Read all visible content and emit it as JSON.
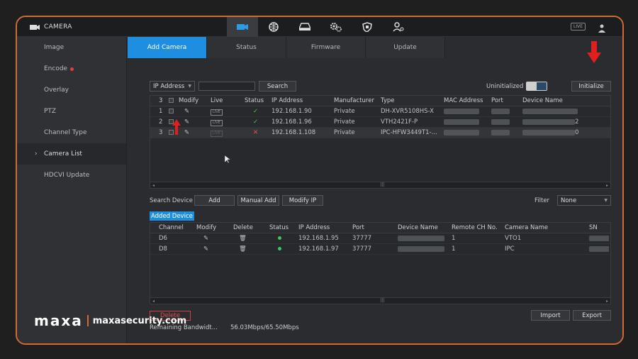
{
  "app": {
    "title": "CAMERA",
    "live_badge": "LIVE"
  },
  "top_icons": [
    "camera-icon",
    "network-icon",
    "storage-icon",
    "settings-icon",
    "security-icon",
    "account-icon"
  ],
  "sidebar": {
    "items": [
      {
        "label": "Image"
      },
      {
        "label": "Encode"
      },
      {
        "label": "Overlay"
      },
      {
        "label": "PTZ"
      },
      {
        "label": "Channel Type"
      },
      {
        "label": "Camera List",
        "active": true
      },
      {
        "label": "HDCVI Update"
      }
    ]
  },
  "tabs": [
    {
      "label": "Add Camera",
      "active": true
    },
    {
      "label": "Status"
    },
    {
      "label": "Firmware"
    },
    {
      "label": "Update"
    }
  ],
  "search_bar": {
    "filter_select": "IP Address",
    "search_button": "Search",
    "uninitialized_label": "Uninitialized",
    "initialize_button": "Initialize"
  },
  "device_table": {
    "count": "3",
    "headers": [
      "Modify",
      "Live",
      "Status",
      "IP Address",
      "Manufacturer",
      "Type",
      "MAC Address",
      "Port",
      "Device Name"
    ],
    "rows": [
      {
        "no": "1",
        "status": "ok",
        "ip": "192.168.1.90",
        "manufacturer": "Private",
        "type": "DH-XVR5108HS-X"
      },
      {
        "no": "2",
        "status": "ok",
        "ip": "192.168.1.96",
        "manufacturer": "Private",
        "type": "VTH2421F-P",
        "name_tail": "2"
      },
      {
        "no": "3",
        "status": "fail",
        "ip": "192.168.1.108",
        "manufacturer": "Private",
        "type": "IPC-HFW3449T1-...",
        "name_tail": "0"
      }
    ]
  },
  "action_bar": {
    "search_device": "Search Device",
    "add": "Add",
    "manual_add": "Manual Add",
    "modify_ip": "Modify IP",
    "filter_label": "Filter",
    "filter_value": "None"
  },
  "added_device": {
    "label": "Added Device",
    "headers": [
      "Channel",
      "Modify",
      "Delete",
      "Status",
      "IP Address",
      "Port",
      "Device Name",
      "Remote CH No.",
      "Camera Name",
      "SN"
    ],
    "rows": [
      {
        "channel": "D6",
        "ip": "192.168.1.95",
        "port": "37777",
        "remote_ch": "1",
        "camera_name": "VTO1"
      },
      {
        "channel": "D8",
        "ip": "192.168.1.97",
        "port": "37777",
        "remote_ch": "1",
        "camera_name": "IPC"
      }
    ]
  },
  "footer": {
    "delete": "Delete",
    "import": "Import",
    "export": "Export",
    "bandwidth_label": "Remaining Bandwidt...",
    "bandwidth_value": "56.03Mbps/65.50Mbps"
  },
  "watermark": {
    "brand": "maxa",
    "site": "maxasecurity.com"
  },
  "colors": {
    "accent": "#1e8fe0",
    "frame": "#d06a36",
    "arrow": "#e02020",
    "ok": "#55c060",
    "fail": "#e05a40"
  }
}
